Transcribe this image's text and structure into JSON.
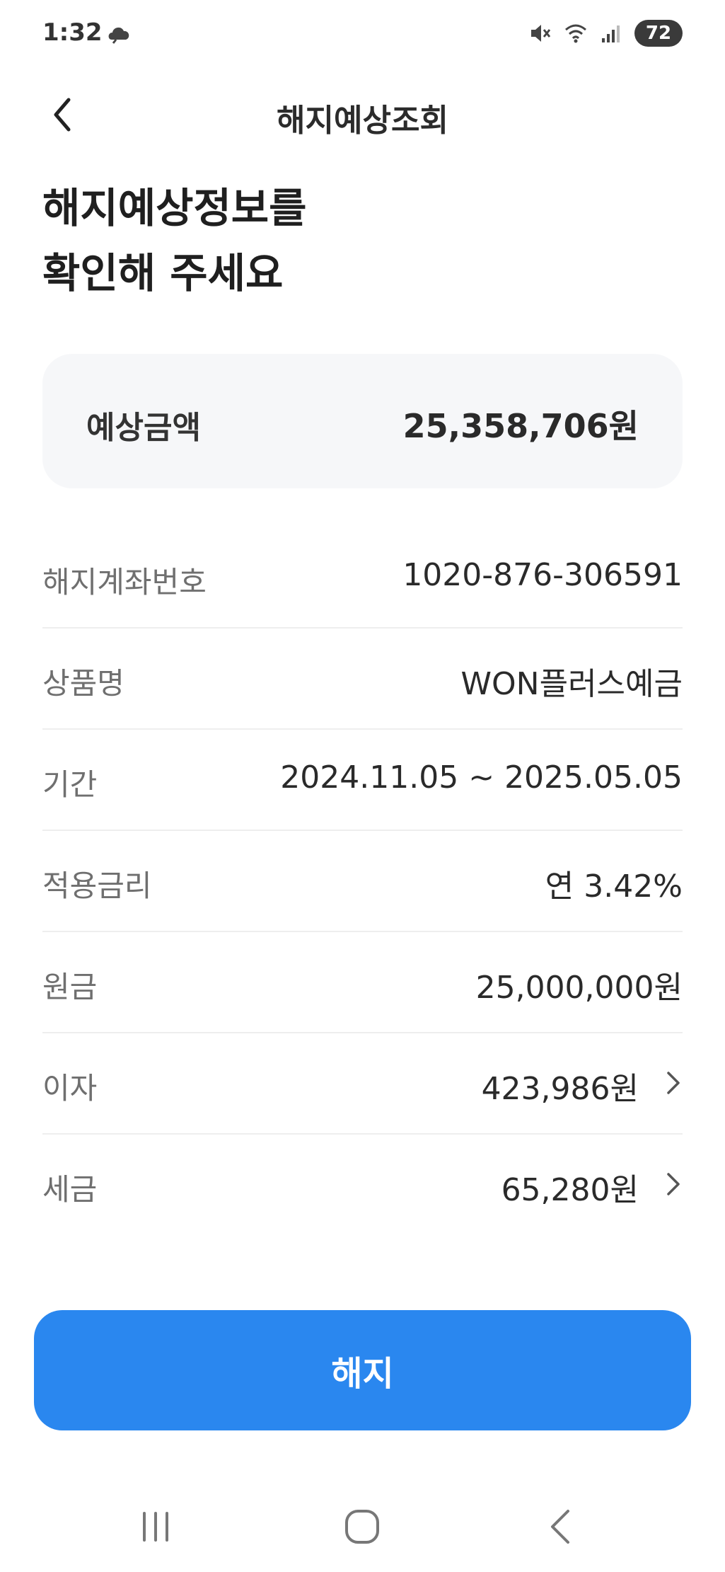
{
  "status_bar": {
    "time": "1:32",
    "battery": "72",
    "icons": [
      "cloud-icon",
      "mute-icon",
      "wifi-icon",
      "signal-icon",
      "battery-icon"
    ]
  },
  "header": {
    "title": "해지예상조회",
    "back_icon": "back-arrow-icon"
  },
  "heading": {
    "line1": "해지예상정보를",
    "line2": "확인해 주세요"
  },
  "summary": {
    "label": "예상금액",
    "value": "25,358,706원"
  },
  "details": [
    {
      "label": "해지계좌번호",
      "value": "1020-876-306591"
    },
    {
      "label": "상품명",
      "value": "WON플러스예금"
    },
    {
      "label": "기간",
      "value": "2024.11.05 ~ 2025.05.05"
    },
    {
      "label": "적용금리",
      "value": "연 3.42%"
    },
    {
      "label": "원금",
      "value": "25,000,000원"
    },
    {
      "label": "이자",
      "value": "423,986원",
      "has_detail": true
    },
    {
      "label": "세금",
      "value": "65,280원",
      "has_detail": true
    }
  ],
  "action": {
    "button_label": "해지",
    "color": "#2a87ef"
  },
  "nav": {
    "items": [
      "recent-apps-icon",
      "home-icon",
      "back-icon"
    ]
  }
}
